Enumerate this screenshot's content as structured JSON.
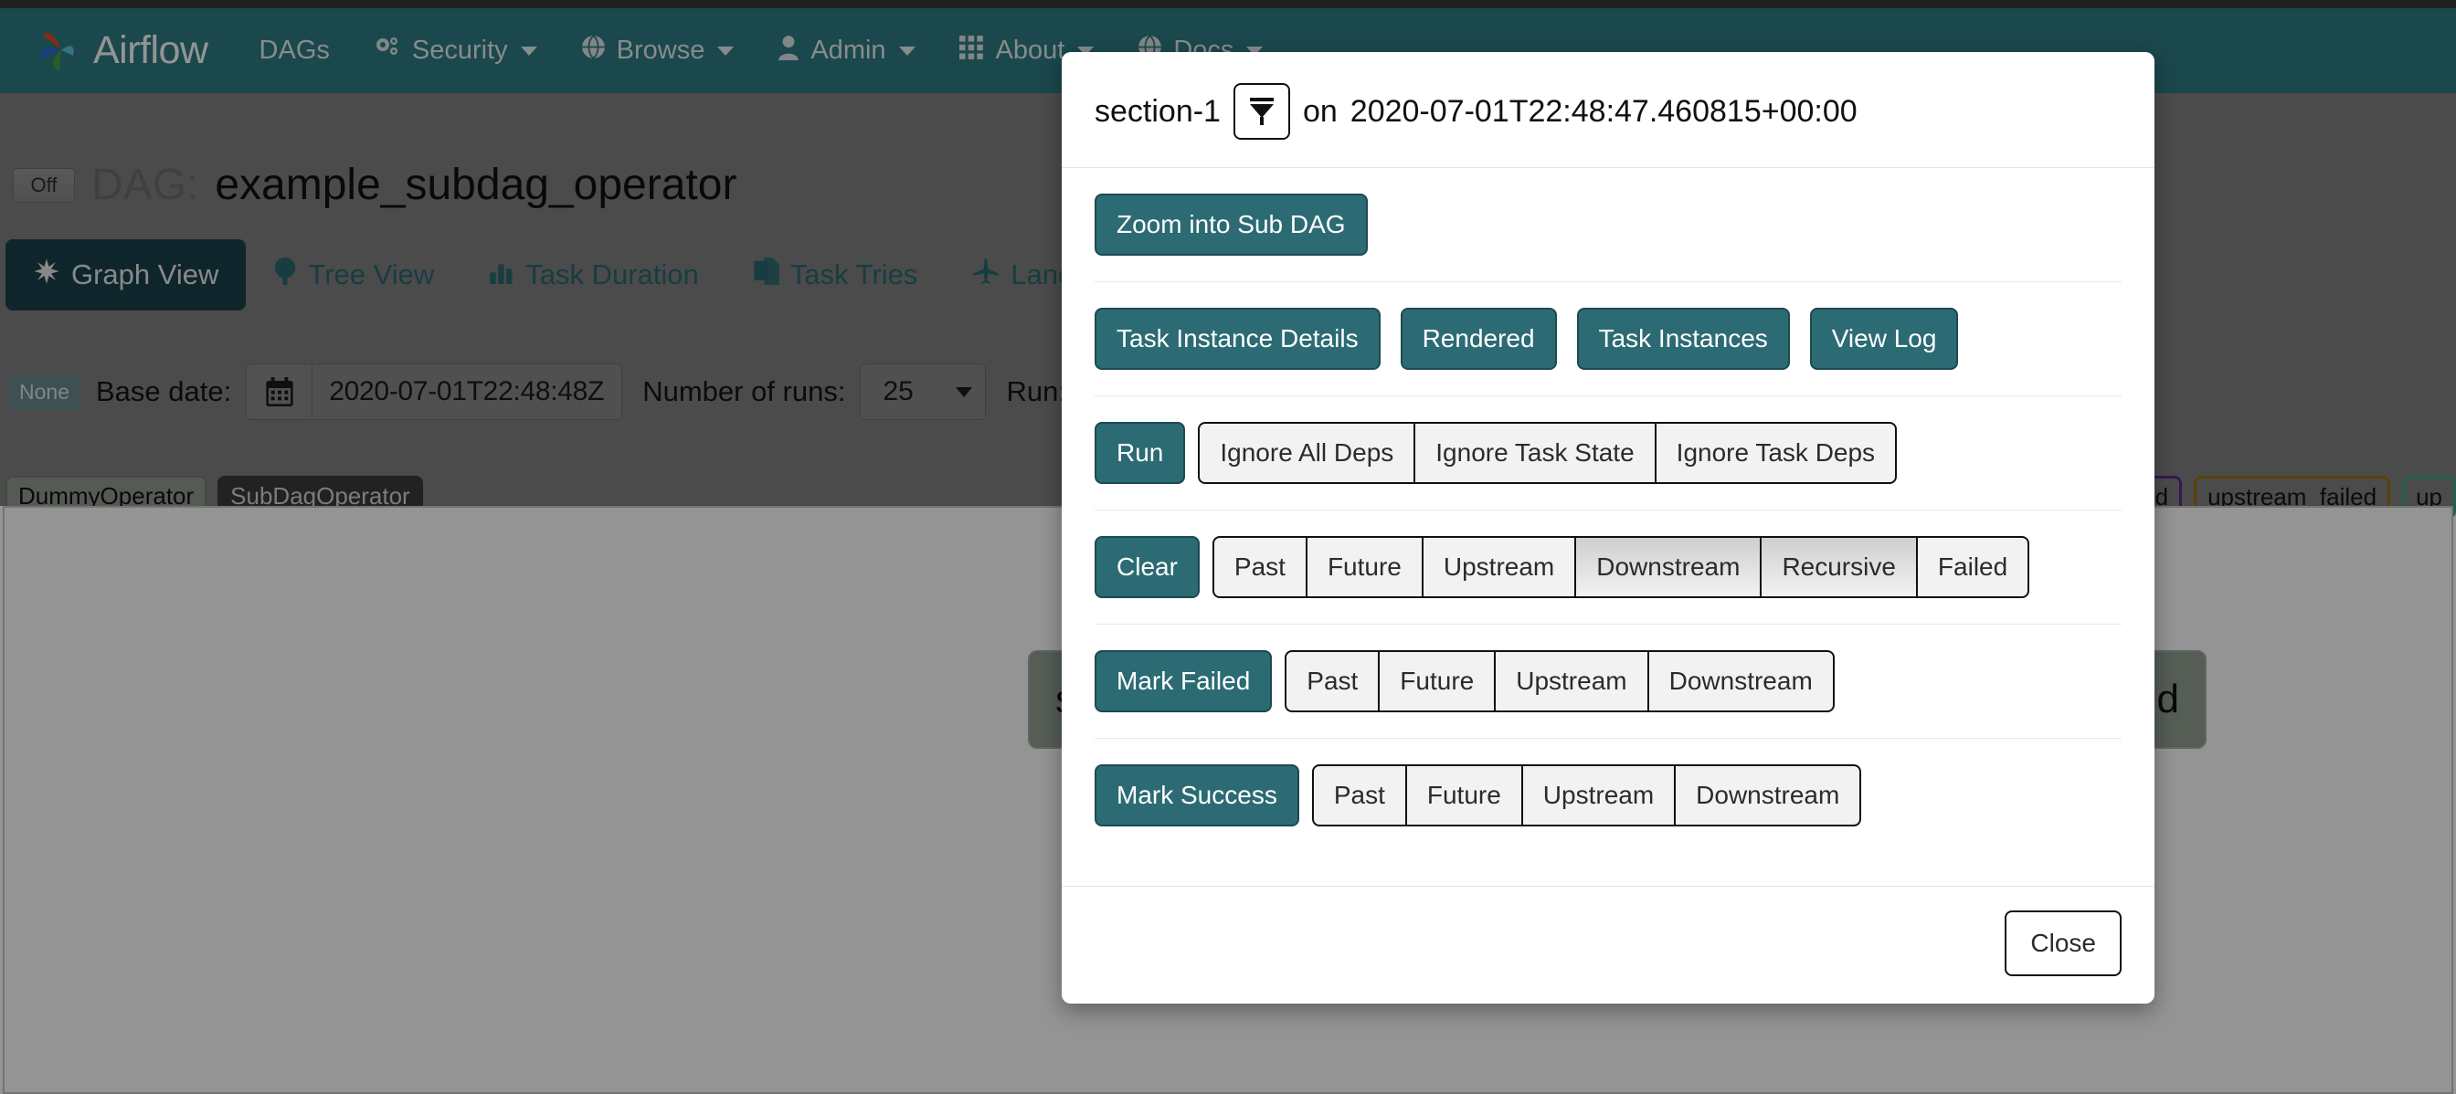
{
  "navbar": {
    "brand": "Airflow",
    "items": [
      {
        "label": "DAGs",
        "icon": "",
        "caret": false
      },
      {
        "label": "Security",
        "icon": "gears-icon",
        "caret": true
      },
      {
        "label": "Browse",
        "icon": "globe-icon",
        "caret": true
      },
      {
        "label": "Admin",
        "icon": "user-icon",
        "caret": true
      },
      {
        "label": "About",
        "icon": "grid-icon",
        "caret": true
      },
      {
        "label": "Docs",
        "icon": "globe-icon",
        "caret": true
      }
    ]
  },
  "dag": {
    "toggle_state": "Off",
    "prefix": "DAG:",
    "name": "example_subdag_operator"
  },
  "tabs": [
    {
      "label": "Graph View",
      "icon": "asterisk-icon",
      "active": true
    },
    {
      "label": "Tree View",
      "icon": "tree-icon",
      "active": false
    },
    {
      "label": "Task Duration",
      "icon": "barchart-icon",
      "active": false
    },
    {
      "label": "Task Tries",
      "icon": "files-icon",
      "active": false
    },
    {
      "label": "Landing Tim",
      "icon": "plane-icon",
      "active": false
    }
  ],
  "filters": {
    "none_badge": "None",
    "base_date_label": "Base date:",
    "base_date_value": "2020-07-01T22:48:48Z",
    "calendar_icon": "calendar-icon",
    "number_of_runs_label": "Number of runs:",
    "number_of_runs_value": "25",
    "run_label": "Run:",
    "run_value": ""
  },
  "legend_left": [
    {
      "label": "DummyOperator",
      "style": "op1"
    },
    {
      "label": "SubDagOperator",
      "style": "op2"
    }
  ],
  "legend_right": [
    {
      "label": "skipped",
      "style": "k"
    },
    {
      "label": "upstream_failed",
      "style": "s"
    },
    {
      "label": "up",
      "style": "t"
    }
  ],
  "graph": {
    "node_left_text": "s",
    "node_right_text": "d"
  },
  "modal": {
    "title_task": "section-1",
    "filter_icon": "funnel-icon",
    "title_on": "on",
    "title_execution_date": "2020-07-01T22:48:47.460815+00:00",
    "zoom_subdag": "Zoom into Sub DAG",
    "details_row": [
      "Task Instance Details",
      "Rendered",
      "Task Instances",
      "View Log"
    ],
    "run_row": {
      "primary": "Run",
      "options": [
        {
          "label": "Ignore All Deps",
          "active": false
        },
        {
          "label": "Ignore Task State",
          "active": false
        },
        {
          "label": "Ignore Task Deps",
          "active": false
        }
      ]
    },
    "clear_row": {
      "primary": "Clear",
      "options": [
        {
          "label": "Past",
          "active": false
        },
        {
          "label": "Future",
          "active": false
        },
        {
          "label": "Upstream",
          "active": false
        },
        {
          "label": "Downstream",
          "active": true
        },
        {
          "label": "Recursive",
          "active": true
        },
        {
          "label": "Failed",
          "active": false
        }
      ]
    },
    "mark_failed_row": {
      "primary": "Mark Failed",
      "options": [
        {
          "label": "Past",
          "active": false
        },
        {
          "label": "Future",
          "active": false
        },
        {
          "label": "Upstream",
          "active": false
        },
        {
          "label": "Downstream",
          "active": false
        }
      ]
    },
    "mark_success_row": {
      "primary": "Mark Success",
      "options": [
        {
          "label": "Past",
          "active": false
        },
        {
          "label": "Future",
          "active": false
        },
        {
          "label": "Upstream",
          "active": false
        },
        {
          "label": "Downstream",
          "active": false
        }
      ]
    },
    "close": "Close"
  },
  "colors": {
    "navbar": "#2e7d85",
    "primary": "#2c6b74",
    "tab_active": "#19424a",
    "page_grey": "#828282"
  }
}
